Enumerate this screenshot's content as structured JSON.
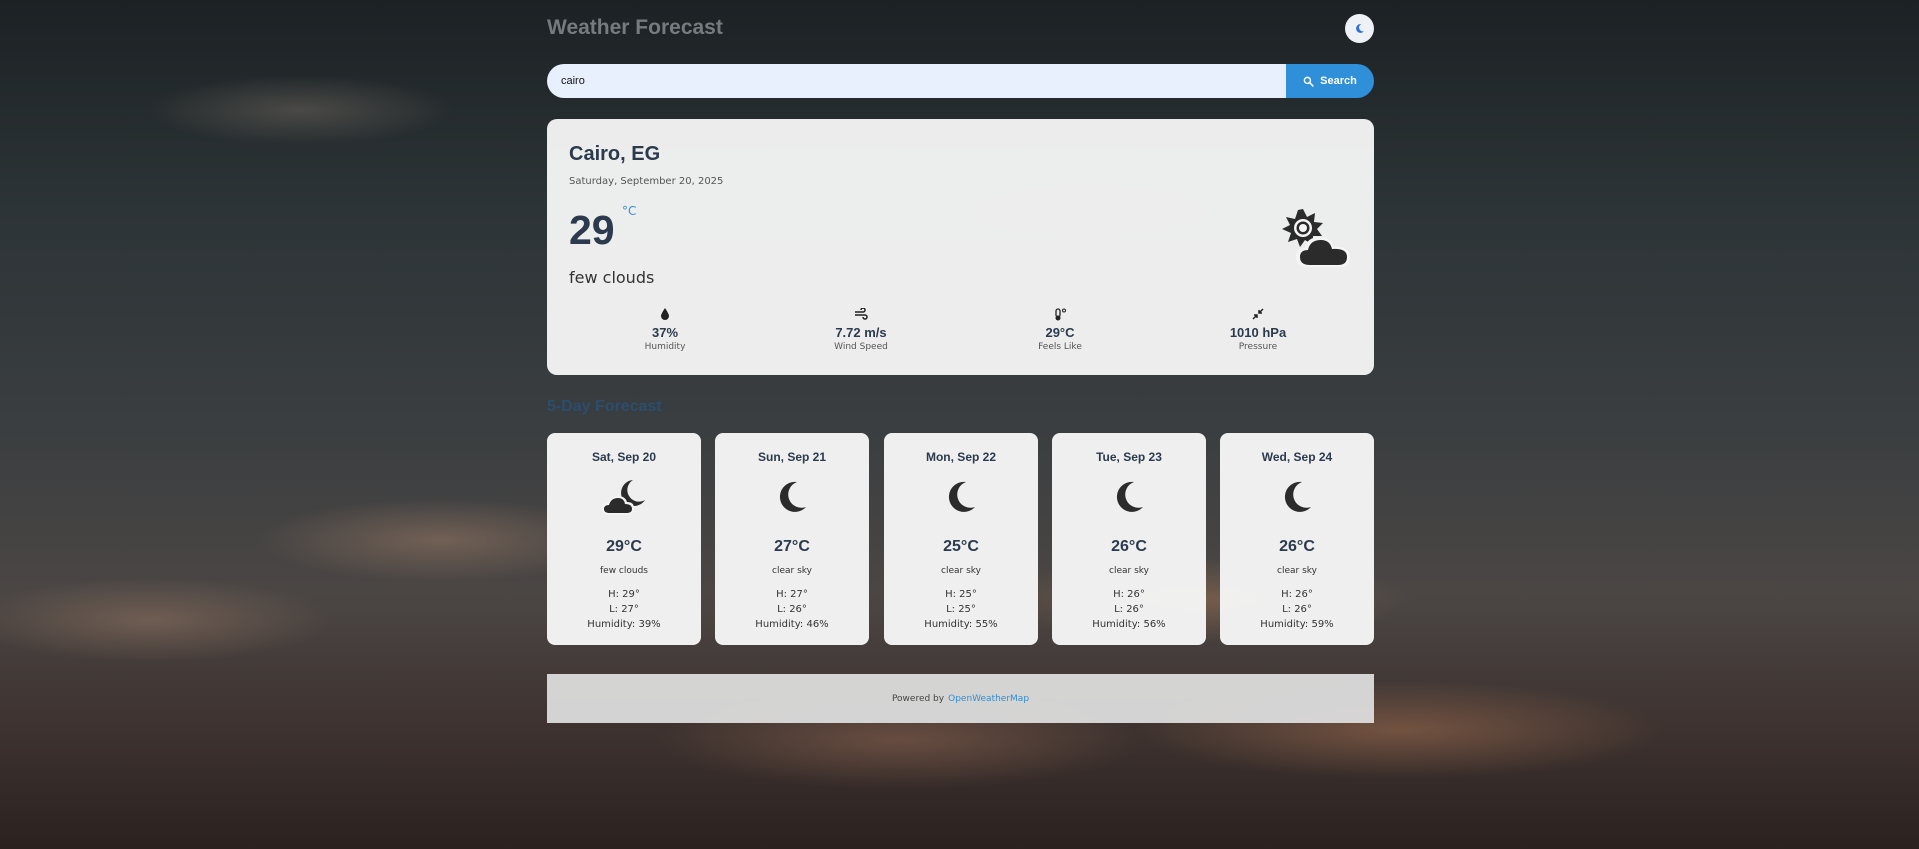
{
  "header": {
    "title": "Weather Forecast",
    "theme_icon": "moon-icon"
  },
  "search": {
    "value": "cairo",
    "placeholder": "",
    "button_label": "Search",
    "button_icon": "search-icon"
  },
  "current": {
    "city": "Cairo, EG",
    "date": "Saturday, September 20, 2025",
    "temp": "29",
    "unit": "°C",
    "description": "few clouds",
    "icon": "sun-cloud-icon",
    "details": [
      {
        "icon": "droplet-icon",
        "value": "37%",
        "label": "Humidity"
      },
      {
        "icon": "wind-icon",
        "value": "7.72 m/s",
        "label": "Wind Speed"
      },
      {
        "icon": "thermometer-icon",
        "value": "29°C",
        "label": "Feels Like"
      },
      {
        "icon": "pressure-icon",
        "value": "1010 hPa",
        "label": "Pressure"
      }
    ]
  },
  "forecast": {
    "title": "5-Day Forecast",
    "days": [
      {
        "date": "Sat, Sep 20",
        "icon": "moon-cloud-icon",
        "temp": "29°C",
        "description": "few clouds",
        "high": "H: 29°",
        "low": "L: 27°",
        "humidity": "Humidity: 39%"
      },
      {
        "date": "Sun, Sep 21",
        "icon": "moon-icon",
        "temp": "27°C",
        "description": "clear sky",
        "high": "H: 27°",
        "low": "L: 26°",
        "humidity": "Humidity: 46%"
      },
      {
        "date": "Mon, Sep 22",
        "icon": "moon-icon",
        "temp": "25°C",
        "description": "clear sky",
        "high": "H: 25°",
        "low": "L: 25°",
        "humidity": "Humidity: 55%"
      },
      {
        "date": "Tue, Sep 23",
        "icon": "moon-icon",
        "temp": "26°C",
        "description": "clear sky",
        "high": "H: 26°",
        "low": "L: 26°",
        "humidity": "Humidity: 56%"
      },
      {
        "date": "Wed, Sep 24",
        "icon": "moon-icon",
        "temp": "26°C",
        "description": "clear sky",
        "high": "H: 26°",
        "low": "L: 26°",
        "humidity": "Humidity: 59%"
      }
    ]
  },
  "footer": {
    "prefix": "Powered by",
    "link_text": "OpenWeatherMap"
  },
  "colors": {
    "accent": "#2f8fd8",
    "title_text": "#2b3a4d",
    "card_bg": "#f5f5f5"
  }
}
